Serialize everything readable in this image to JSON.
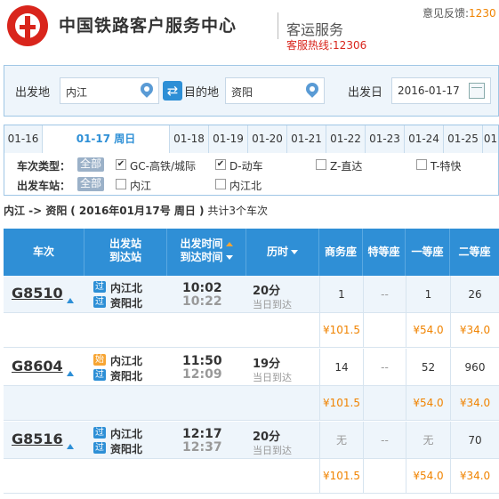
{
  "header": {
    "brand_title": "中国铁路客户服务中心",
    "brand_sub": "客运服务",
    "hotline": "客服热线:12306",
    "feedback_label": "意见反馈:",
    "feedback_value": "1230"
  },
  "search": {
    "from_label": "出发地",
    "from_value": "内江",
    "to_label": "目的地",
    "to_value": "资阳",
    "date_label": "出发日",
    "date_value": "2016-01-17"
  },
  "date_tabs": [
    {
      "label": "01-16",
      "active": false
    },
    {
      "label": "01-17 周日",
      "active": true
    },
    {
      "label": "01-18",
      "active": false
    },
    {
      "label": "01-19",
      "active": false
    },
    {
      "label": "01-20",
      "active": false
    },
    {
      "label": "01-21",
      "active": false
    },
    {
      "label": "01-22",
      "active": false
    },
    {
      "label": "01-23",
      "active": false
    },
    {
      "label": "01-24",
      "active": false
    },
    {
      "label": "01-25",
      "active": false
    },
    {
      "label": "01",
      "active": false
    }
  ],
  "filters": {
    "type_label": "车次类型：",
    "all_label": "全部",
    "types": [
      {
        "label": "GC-高铁/城际",
        "checked": true
      },
      {
        "label": "D-动车",
        "checked": true
      },
      {
        "label": "Z-直达",
        "checked": false
      },
      {
        "label": "T-特快",
        "checked": false
      }
    ],
    "station_label": "出发车站：",
    "stations": [
      {
        "label": "内江",
        "checked": false
      },
      {
        "label": "内江北",
        "checked": false
      }
    ]
  },
  "summary": {
    "route": "内江 -> 资阳",
    "date": "( 2016年01月17号 周日 )",
    "count": "共计3个车次"
  },
  "table_header": {
    "train": "车次",
    "station_line1": "出发站",
    "station_line2": "到达站",
    "time_line1": "出发时间",
    "time_line2": "到达时间",
    "duration": "历时",
    "business": "商务座",
    "premium": "特等座",
    "first": "一等座",
    "second": "二等座"
  },
  "trains": [
    {
      "no": "G8510",
      "from_badge": "过",
      "from_station": "内江北",
      "to_badge": "过",
      "to_station": "资阳北",
      "dep": "10:02",
      "arr": "10:22",
      "duration": "20分",
      "arrive_day": "当日到达",
      "business": "1",
      "premium": "--",
      "first": "1",
      "second": "26",
      "price_business": "¥101.5",
      "price_first": "¥54.0",
      "price_second": "¥34.0"
    },
    {
      "no": "G8604",
      "from_badge": "始",
      "from_station": "内江北",
      "to_badge": "过",
      "to_station": "资阳北",
      "dep": "11:50",
      "arr": "12:09",
      "duration": "19分",
      "arrive_day": "当日到达",
      "business": "14",
      "premium": "--",
      "first": "52",
      "second": "960",
      "price_business": "¥101.5",
      "price_first": "¥54.0",
      "price_second": "¥34.0"
    },
    {
      "no": "G8516",
      "from_badge": "过",
      "from_station": "内江北",
      "to_badge": "过",
      "to_station": "资阳北",
      "dep": "12:17",
      "arr": "12:37",
      "duration": "20分",
      "arrive_day": "当日到达",
      "business": "无",
      "premium": "--",
      "first": "无",
      "second": "70",
      "price_business": "¥101.5",
      "price_first": "¥54.0",
      "price_second": "¥34.0"
    }
  ]
}
